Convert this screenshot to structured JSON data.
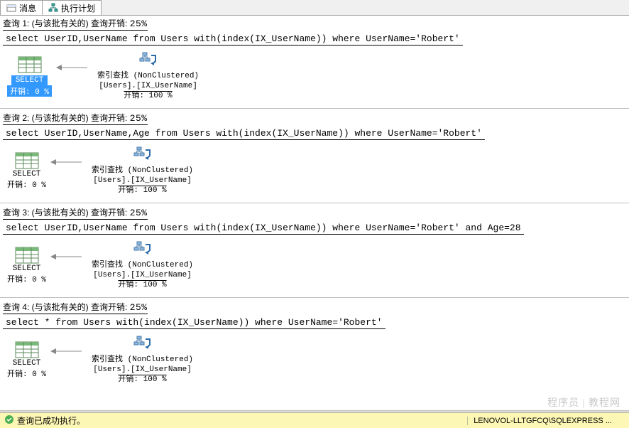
{
  "tabs": {
    "messages": "消息",
    "plan": "执行计划"
  },
  "queries": [
    {
      "header_prefix": "查询 1: (与该批有关的)",
      "header_cost_label": "查询开销: ",
      "header_cost_value": "25%",
      "sql": "select UserID,UserName from Users with(index(IX_UserName)) where UserName='Robert'",
      "select_node": {
        "label": "SELECT",
        "cost": "开销: 0 %",
        "highlighted": true
      },
      "seek_node": {
        "title": "索引查找 (NonClustered)",
        "object": "[Users].[IX_UserName]",
        "cost": "开销: 100 %"
      }
    },
    {
      "header_prefix": "查询 2: (与该批有关的)",
      "header_cost_label": "查询开销: ",
      "header_cost_value": "25%",
      "sql": "select UserID,UserName,Age from Users with(index(IX_UserName)) where UserName='Robert'",
      "select_node": {
        "label": "SELECT",
        "cost": "开销: 0 %",
        "highlighted": false
      },
      "seek_node": {
        "title": "索引查找 (NonClustered)",
        "object": "[Users].[IX_UserName]",
        "cost": "开销: 100 %"
      }
    },
    {
      "header_prefix": "查询 3: (与该批有关的)",
      "header_cost_label": "查询开销: ",
      "header_cost_value": "25%",
      "sql": "select UserID,UserName from Users with(index(IX_UserName)) where UserName='Robert' and Age=28",
      "select_node": {
        "label": "SELECT",
        "cost": "开销: 0 %",
        "highlighted": false
      },
      "seek_node": {
        "title": "索引查找 (NonClustered)",
        "object": "[Users].[IX_UserName]",
        "cost": "开销: 100 %"
      }
    },
    {
      "header_prefix": "查询 4: (与该批有关的)",
      "header_cost_label": "查询开销: ",
      "header_cost_value": "25%",
      "sql": "select * from Users with(index(IX_UserName)) where UserName='Robert'",
      "select_node": {
        "label": "SELECT",
        "cost": "开销: 0 %",
        "highlighted": false
      },
      "seek_node": {
        "title": "索引查找 (NonClustered)",
        "object": "[Users].[IX_UserName]",
        "cost": "开销: 100 %"
      }
    }
  ],
  "statusbar": {
    "success_text": "查询已成功执行。",
    "server": "LENOVOL-LLTGFCQ\\SQLEXPRESS ..."
  },
  "watermark": "程序员 | 教程网"
}
